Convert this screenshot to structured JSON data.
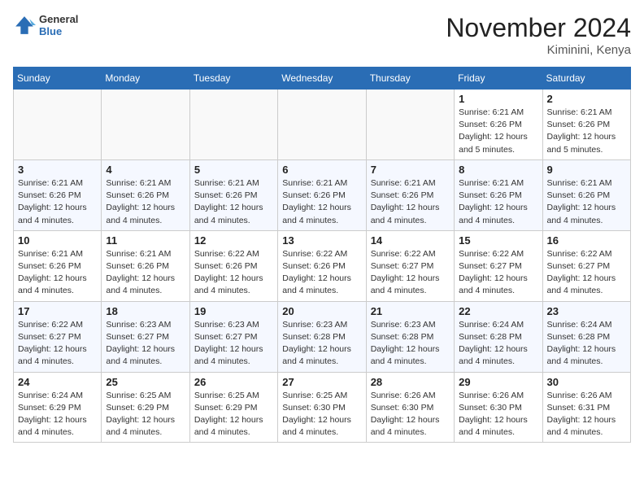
{
  "header": {
    "logo_general": "General",
    "logo_blue": "Blue",
    "month_title": "November 2024",
    "location": "Kiminini, Kenya"
  },
  "days_of_week": [
    "Sunday",
    "Monday",
    "Tuesday",
    "Wednesday",
    "Thursday",
    "Friday",
    "Saturday"
  ],
  "weeks": [
    [
      {
        "day": "",
        "info": ""
      },
      {
        "day": "",
        "info": ""
      },
      {
        "day": "",
        "info": ""
      },
      {
        "day": "",
        "info": ""
      },
      {
        "day": "",
        "info": ""
      },
      {
        "day": "1",
        "info": "Sunrise: 6:21 AM\nSunset: 6:26 PM\nDaylight: 12 hours and 5 minutes."
      },
      {
        "day": "2",
        "info": "Sunrise: 6:21 AM\nSunset: 6:26 PM\nDaylight: 12 hours and 5 minutes."
      }
    ],
    [
      {
        "day": "3",
        "info": "Sunrise: 6:21 AM\nSunset: 6:26 PM\nDaylight: 12 hours and 4 minutes."
      },
      {
        "day": "4",
        "info": "Sunrise: 6:21 AM\nSunset: 6:26 PM\nDaylight: 12 hours and 4 minutes."
      },
      {
        "day": "5",
        "info": "Sunrise: 6:21 AM\nSunset: 6:26 PM\nDaylight: 12 hours and 4 minutes."
      },
      {
        "day": "6",
        "info": "Sunrise: 6:21 AM\nSunset: 6:26 PM\nDaylight: 12 hours and 4 minutes."
      },
      {
        "day": "7",
        "info": "Sunrise: 6:21 AM\nSunset: 6:26 PM\nDaylight: 12 hours and 4 minutes."
      },
      {
        "day": "8",
        "info": "Sunrise: 6:21 AM\nSunset: 6:26 PM\nDaylight: 12 hours and 4 minutes."
      },
      {
        "day": "9",
        "info": "Sunrise: 6:21 AM\nSunset: 6:26 PM\nDaylight: 12 hours and 4 minutes."
      }
    ],
    [
      {
        "day": "10",
        "info": "Sunrise: 6:21 AM\nSunset: 6:26 PM\nDaylight: 12 hours and 4 minutes."
      },
      {
        "day": "11",
        "info": "Sunrise: 6:21 AM\nSunset: 6:26 PM\nDaylight: 12 hours and 4 minutes."
      },
      {
        "day": "12",
        "info": "Sunrise: 6:22 AM\nSunset: 6:26 PM\nDaylight: 12 hours and 4 minutes."
      },
      {
        "day": "13",
        "info": "Sunrise: 6:22 AM\nSunset: 6:26 PM\nDaylight: 12 hours and 4 minutes."
      },
      {
        "day": "14",
        "info": "Sunrise: 6:22 AM\nSunset: 6:27 PM\nDaylight: 12 hours and 4 minutes."
      },
      {
        "day": "15",
        "info": "Sunrise: 6:22 AM\nSunset: 6:27 PM\nDaylight: 12 hours and 4 minutes."
      },
      {
        "day": "16",
        "info": "Sunrise: 6:22 AM\nSunset: 6:27 PM\nDaylight: 12 hours and 4 minutes."
      }
    ],
    [
      {
        "day": "17",
        "info": "Sunrise: 6:22 AM\nSunset: 6:27 PM\nDaylight: 12 hours and 4 minutes."
      },
      {
        "day": "18",
        "info": "Sunrise: 6:23 AM\nSunset: 6:27 PM\nDaylight: 12 hours and 4 minutes."
      },
      {
        "day": "19",
        "info": "Sunrise: 6:23 AM\nSunset: 6:27 PM\nDaylight: 12 hours and 4 minutes."
      },
      {
        "day": "20",
        "info": "Sunrise: 6:23 AM\nSunset: 6:28 PM\nDaylight: 12 hours and 4 minutes."
      },
      {
        "day": "21",
        "info": "Sunrise: 6:23 AM\nSunset: 6:28 PM\nDaylight: 12 hours and 4 minutes."
      },
      {
        "day": "22",
        "info": "Sunrise: 6:24 AM\nSunset: 6:28 PM\nDaylight: 12 hours and 4 minutes."
      },
      {
        "day": "23",
        "info": "Sunrise: 6:24 AM\nSunset: 6:28 PM\nDaylight: 12 hours and 4 minutes."
      }
    ],
    [
      {
        "day": "24",
        "info": "Sunrise: 6:24 AM\nSunset: 6:29 PM\nDaylight: 12 hours and 4 minutes."
      },
      {
        "day": "25",
        "info": "Sunrise: 6:25 AM\nSunset: 6:29 PM\nDaylight: 12 hours and 4 minutes."
      },
      {
        "day": "26",
        "info": "Sunrise: 6:25 AM\nSunset: 6:29 PM\nDaylight: 12 hours and 4 minutes."
      },
      {
        "day": "27",
        "info": "Sunrise: 6:25 AM\nSunset: 6:30 PM\nDaylight: 12 hours and 4 minutes."
      },
      {
        "day": "28",
        "info": "Sunrise: 6:26 AM\nSunset: 6:30 PM\nDaylight: 12 hours and 4 minutes."
      },
      {
        "day": "29",
        "info": "Sunrise: 6:26 AM\nSunset: 6:30 PM\nDaylight: 12 hours and 4 minutes."
      },
      {
        "day": "30",
        "info": "Sunrise: 6:26 AM\nSunset: 6:31 PM\nDaylight: 12 hours and 4 minutes."
      }
    ]
  ]
}
